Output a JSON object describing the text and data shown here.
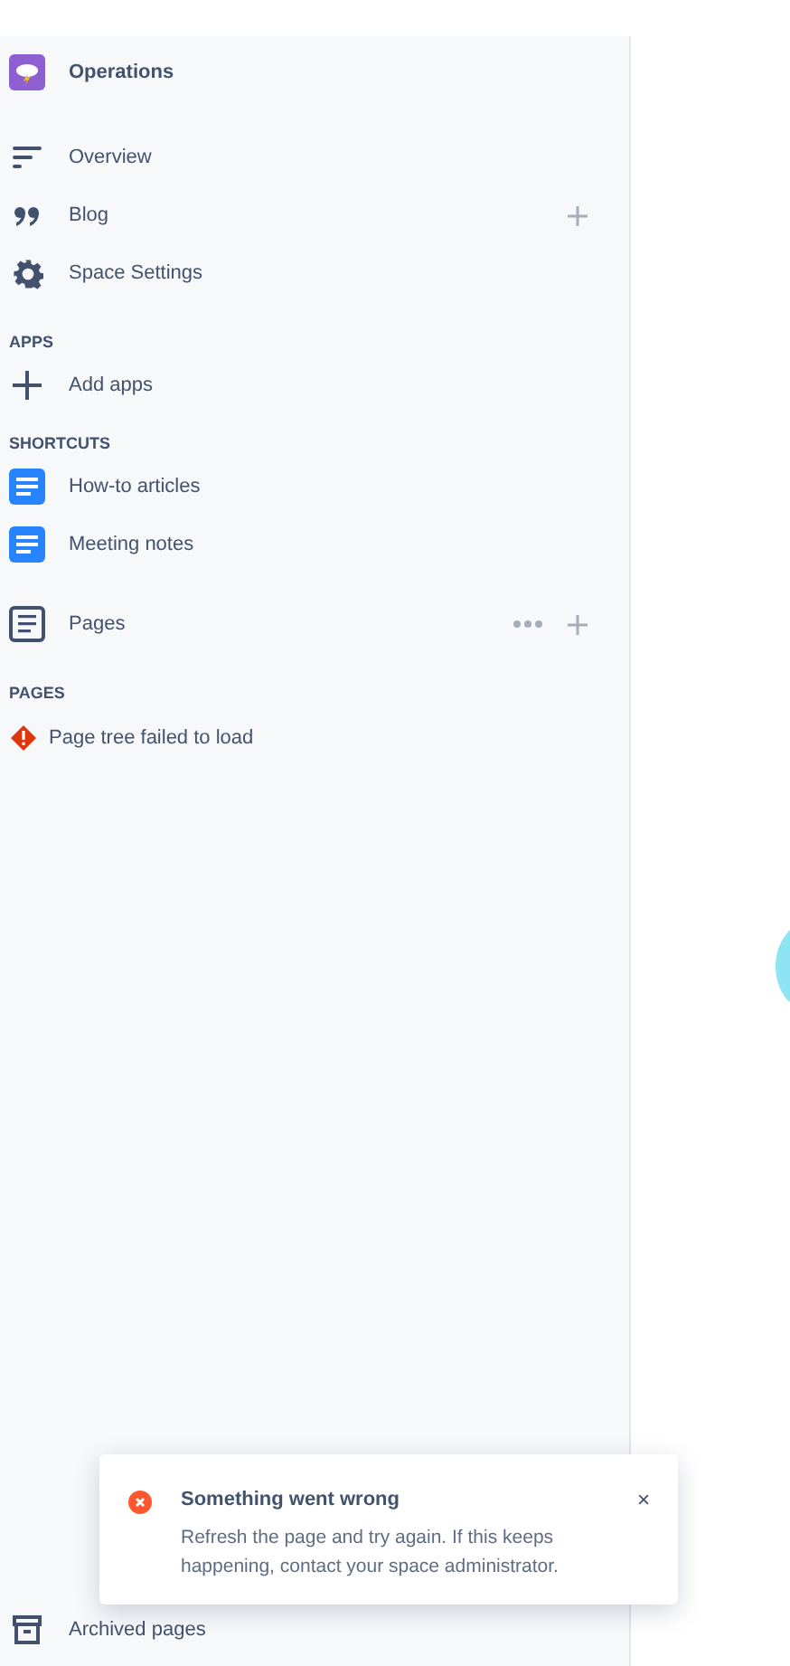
{
  "space": {
    "name": "Operations"
  },
  "nav": [
    {
      "kind": "overview",
      "label": "Overview",
      "add_button": false
    },
    {
      "kind": "blog",
      "label": "Blog",
      "add_button": true
    },
    {
      "kind": "settings",
      "label": "Space Settings",
      "add_button": false
    }
  ],
  "apps": {
    "heading": "APPS",
    "items": [
      {
        "kind": "add",
        "label": "Add apps"
      }
    ]
  },
  "shortcuts": {
    "heading": "SHORTCUTS",
    "items": [
      {
        "kind": "doc",
        "label": "How-to articles"
      },
      {
        "kind": "doc",
        "label": "Meeting notes"
      }
    ]
  },
  "pages_link": {
    "label": "Pages",
    "more_button": true,
    "add_button": true
  },
  "pages": {
    "heading": "PAGES",
    "error": "Page tree failed to load"
  },
  "footer": {
    "label": "Archived pages"
  },
  "toast": {
    "kind": "error",
    "title": "Something went wrong",
    "message": "Refresh the page and try again. If this keeps happening, contact your space administrator."
  }
}
